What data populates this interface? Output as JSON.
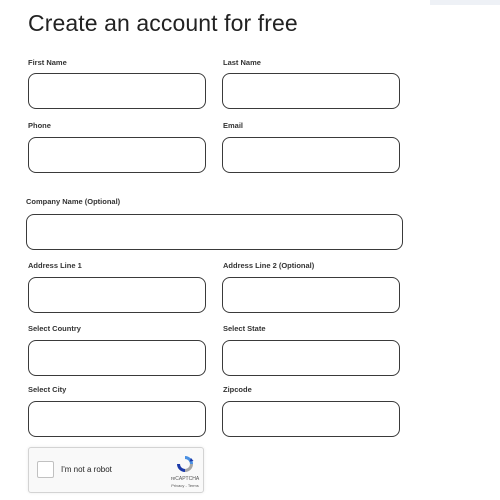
{
  "page": {
    "title": "Create an account for free"
  },
  "form": {
    "first_name_label": "First Name",
    "last_name_label": "Last Name",
    "phone_label": "Phone",
    "email_label": "Email",
    "company_label": "Company Name (Optional)",
    "address1_label": "Address Line 1",
    "address2_label": "Address Line 2 (Optional)",
    "country_label": "Select Country",
    "state_label": "Select State",
    "city_label": "Select City",
    "zipcode_label": "Zipcode"
  },
  "recaptcha": {
    "label": "I'm not a robot",
    "brand": "reCAPTCHA",
    "terms": "Privacy - Terms"
  },
  "colors": {
    "border": "#3a3a3a",
    "recaptcha_blue": "#1c3aa9",
    "recaptcha_lightblue": "#4a90e2",
    "recaptcha_gray": "#a6a6a6"
  }
}
